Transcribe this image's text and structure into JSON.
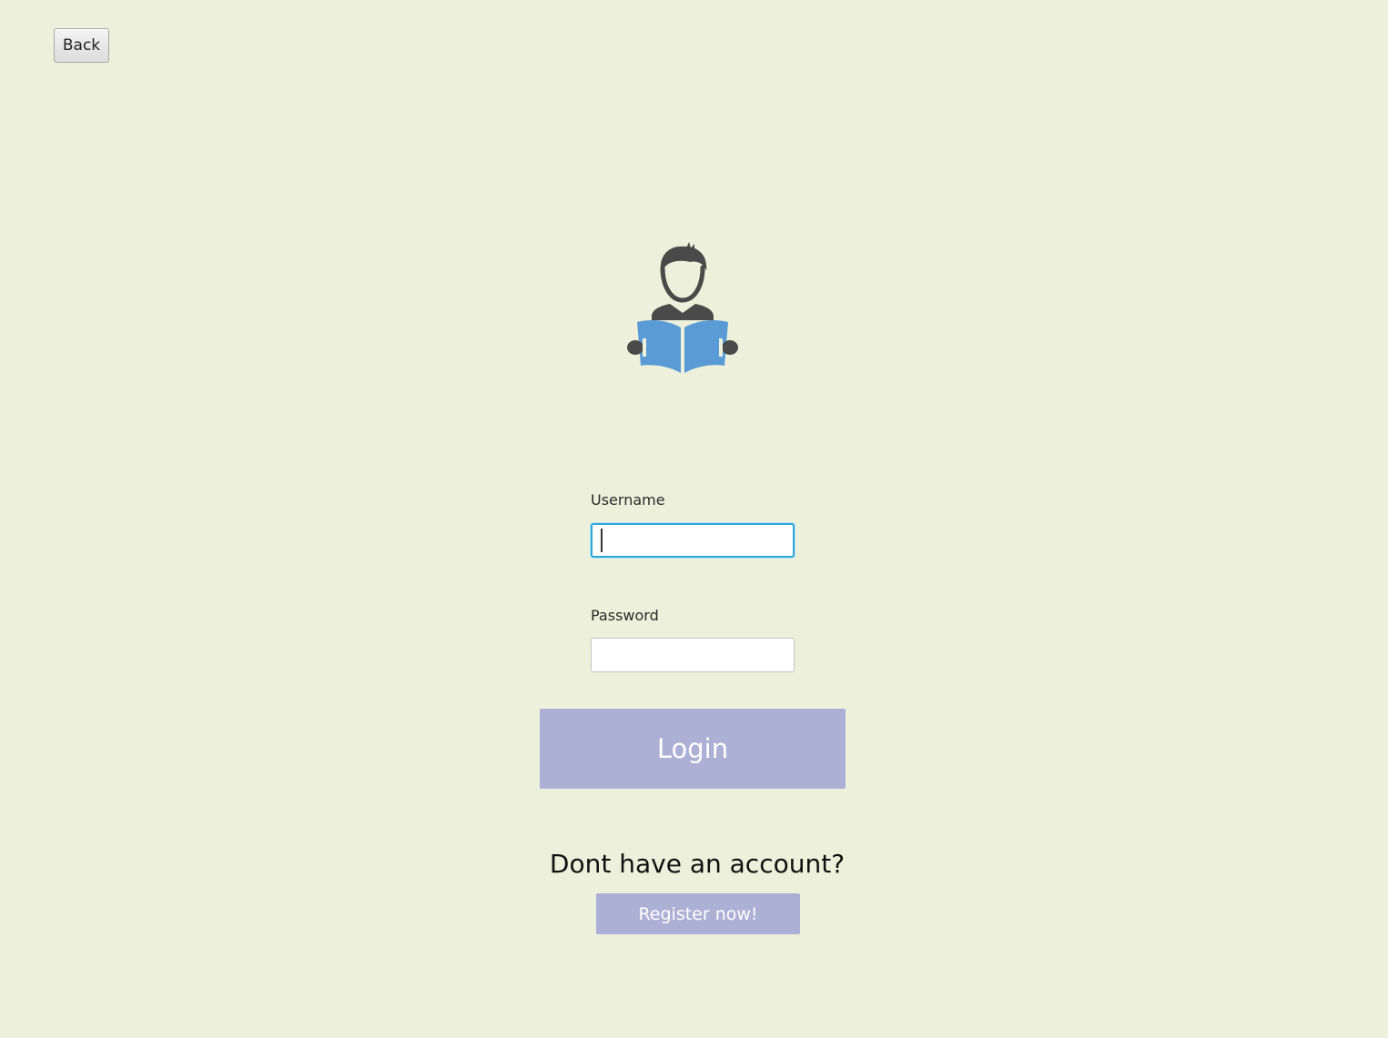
{
  "header": {
    "back_label": "Back"
  },
  "logo": {
    "icon": "reader-with-book-icon",
    "colors": {
      "figure": "#4a4a4a",
      "book": "#5a9bd5"
    }
  },
  "form": {
    "username_label": "Username",
    "username_value": "",
    "username_placeholder": "",
    "password_label": "Password",
    "password_value": "",
    "password_placeholder": "",
    "login_label": "Login"
  },
  "register": {
    "prompt": "Dont have an account?",
    "button_label": "Register now!"
  },
  "colors": {
    "background": "#edf0da",
    "accent_button": "#adb0d5",
    "focus_border": "#2aa6d8"
  }
}
